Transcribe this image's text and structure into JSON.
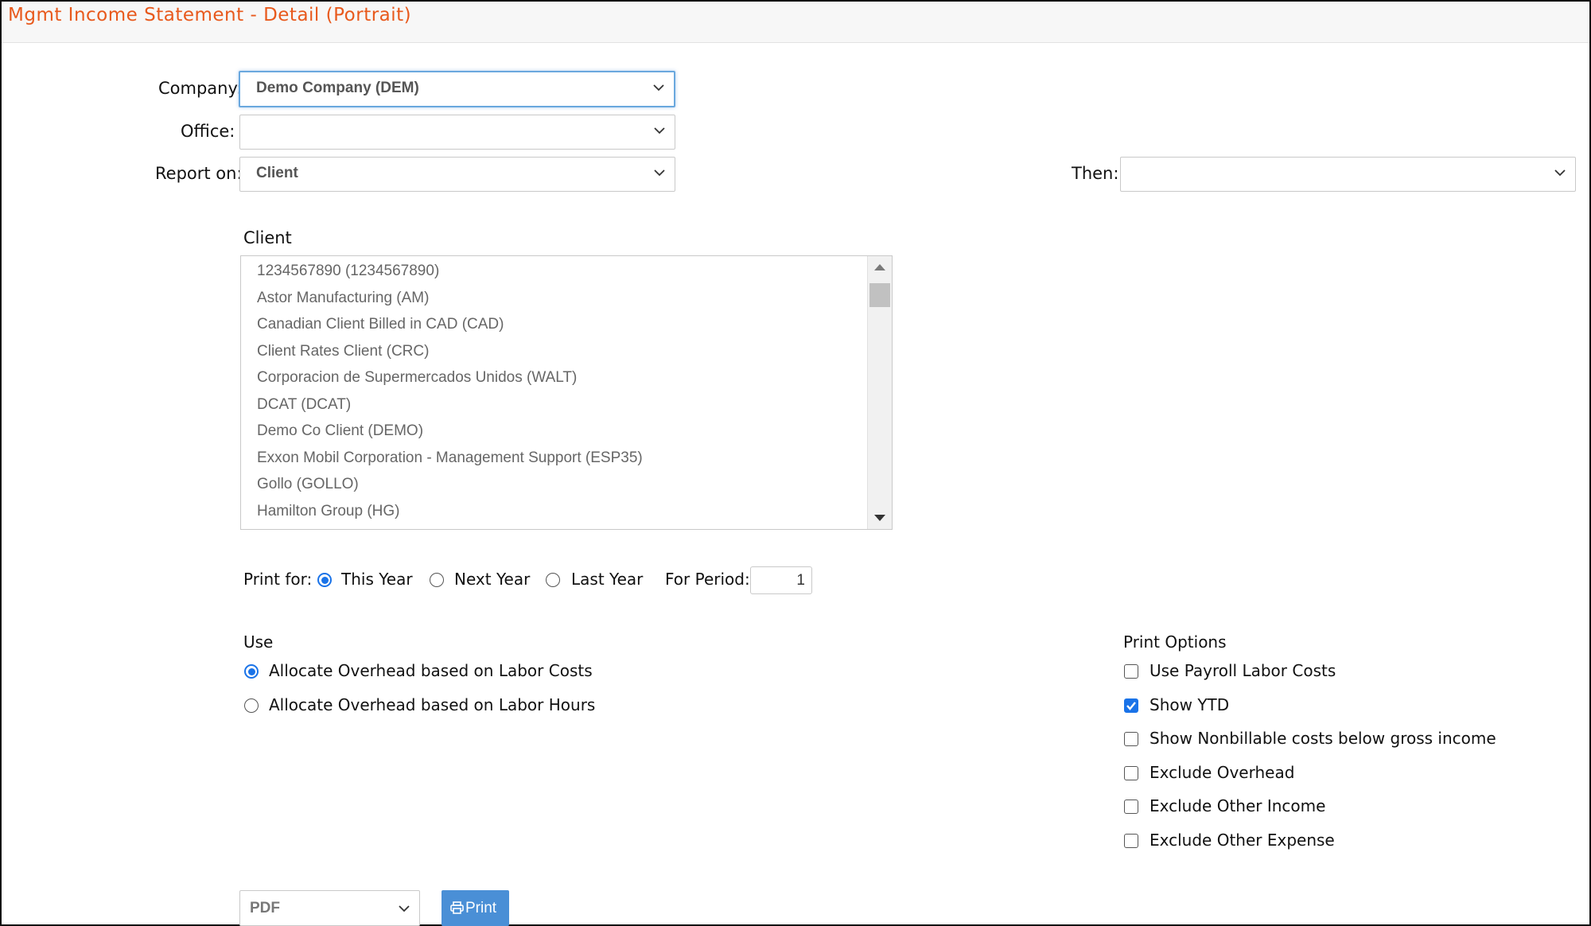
{
  "window": {
    "title": "Mgmt Income Statement - Detail (Portrait)",
    "title_color": "#e8591c"
  },
  "form": {
    "company": {
      "label": "Company:",
      "value": "Demo Company (DEM)"
    },
    "office": {
      "label": "Office:",
      "value": ""
    },
    "report_on": {
      "label": "Report on:",
      "value": "Client"
    },
    "then": {
      "label": "Then:",
      "value": ""
    }
  },
  "client_list": {
    "heading": "Client",
    "items": [
      "1234567890 (1234567890)",
      "Astor Manufacturing (AM)",
      "Canadian Client Billed in CAD (CAD)",
      "Client Rates Client (CRC)",
      "Corporacion de Supermercados Unidos (WALT)",
      "DCAT (DCAT)",
      "Demo Co Client (DEMO)",
      "Exxon Mobil Corporation - Management Support (ESP35)",
      "Gollo (GOLLO)",
      "Hamilton Group (HG)"
    ]
  },
  "print_for": {
    "label": "Print for:",
    "options": [
      "This Year",
      "Next Year",
      "Last Year"
    ],
    "selected": "This Year",
    "period_label": "For Period:",
    "period_value": "1"
  },
  "use": {
    "heading": "Use",
    "options": [
      "Allocate Overhead based on Labor Costs",
      "Allocate Overhead based on Labor Hours"
    ],
    "selected": "Allocate Overhead based on Labor Costs"
  },
  "print_options": {
    "heading": "Print Options",
    "items": [
      {
        "label": "Use Payroll Labor Costs",
        "checked": false
      },
      {
        "label": "Show YTD",
        "checked": true
      },
      {
        "label": "Show Nonbillable costs below gross income",
        "checked": false
      },
      {
        "label": "Exclude Overhead",
        "checked": false
      },
      {
        "label": "Exclude Other Income",
        "checked": false
      },
      {
        "label": "Exclude Other Expense",
        "checked": false
      }
    ]
  },
  "output": {
    "format": "PDF",
    "print_label": "Print"
  },
  "colors": {
    "accent": "#1a73e8",
    "button": "#4a8fd6"
  }
}
